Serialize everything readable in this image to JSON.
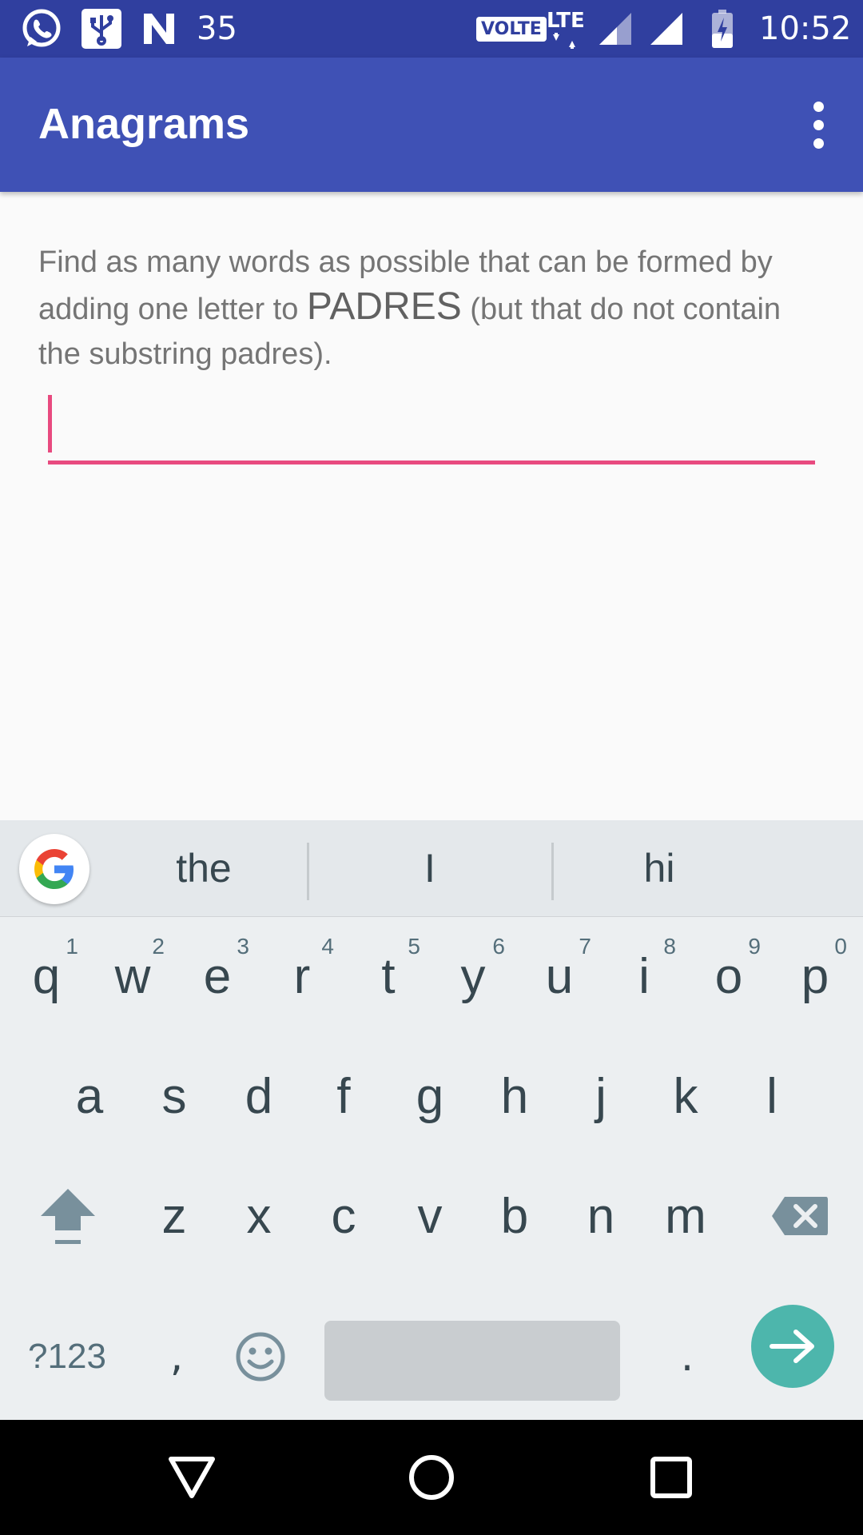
{
  "status_bar": {
    "notification_count": "35",
    "volte_label": "VOLTE",
    "network_label": "LTE",
    "time": "10:52"
  },
  "app_bar": {
    "title": "Anagrams"
  },
  "instructions": {
    "text_before": "Find as many words as possible that can be formed by adding one letter to ",
    "word": "PADRES",
    "text_after": " (but that do not contain the substring padres)."
  },
  "word_input": {
    "value": ""
  },
  "keyboard": {
    "suggestions": [
      "the",
      "I",
      "hi"
    ],
    "rows": [
      [
        {
          "key": "q",
          "hint": "1"
        },
        {
          "key": "w",
          "hint": "2"
        },
        {
          "key": "e",
          "hint": "3"
        },
        {
          "key": "r",
          "hint": "4"
        },
        {
          "key": "t",
          "hint": "5"
        },
        {
          "key": "y",
          "hint": "6"
        },
        {
          "key": "u",
          "hint": "7"
        },
        {
          "key": "i",
          "hint": "8"
        },
        {
          "key": "o",
          "hint": "9"
        },
        {
          "key": "p",
          "hint": "0"
        }
      ],
      [
        {
          "key": "a"
        },
        {
          "key": "s"
        },
        {
          "key": "d"
        },
        {
          "key": "f"
        },
        {
          "key": "g"
        },
        {
          "key": "h"
        },
        {
          "key": "j"
        },
        {
          "key": "k"
        },
        {
          "key": "l"
        }
      ],
      [
        {
          "key": "z"
        },
        {
          "key": "x"
        },
        {
          "key": "c"
        },
        {
          "key": "v"
        },
        {
          "key": "b"
        },
        {
          "key": "n"
        },
        {
          "key": "m"
        }
      ]
    ],
    "symbols_label": "?123",
    "comma_label": ",",
    "period_label": "."
  },
  "colors": {
    "status_bar": "#303f9f",
    "app_bar": "#3f51b5",
    "accent": "#e84a7f",
    "enter_key": "#4db6ac",
    "keyboard_bg": "#eceff1"
  },
  "icons": {
    "status_bar": [
      "whatsapp-icon",
      "usb-icon",
      "n-icon",
      "volte-icon",
      "lte-icon",
      "signal-icon",
      "battery-charging-icon"
    ],
    "app_bar": [
      "more-vert-icon"
    ],
    "keyboard": [
      "google-icon",
      "shift-icon",
      "backspace-icon",
      "emoji-icon",
      "enter-arrow-icon"
    ],
    "nav_bar": [
      "back-icon",
      "home-icon",
      "recents-icon"
    ]
  }
}
